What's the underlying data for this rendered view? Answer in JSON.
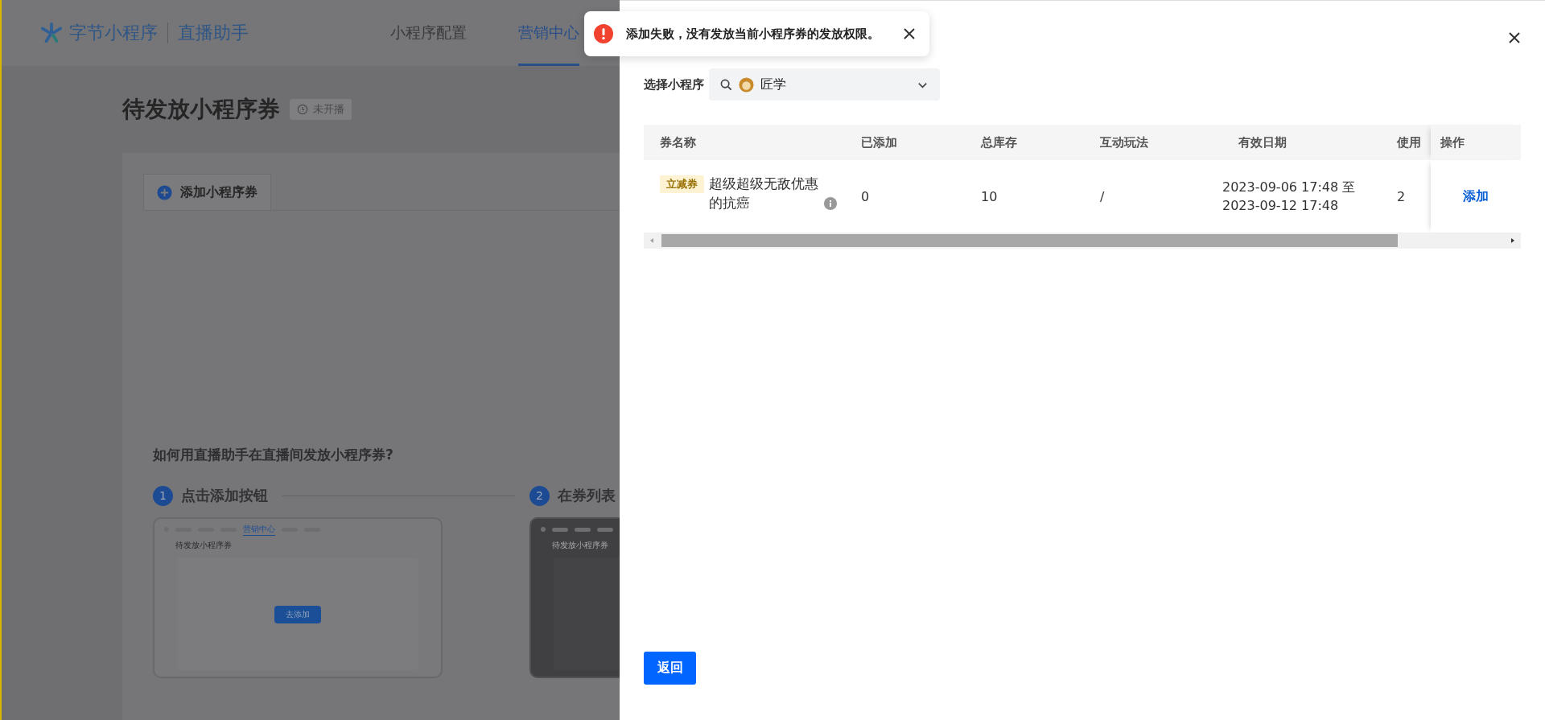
{
  "background_page": {
    "header": {
      "logo": "字节小程序",
      "product": "直播助手",
      "nav": [
        {
          "label": "小程序配置",
          "selected": false
        },
        {
          "label": "营销中心",
          "selected": true
        }
      ]
    },
    "title": "待发放小程序券",
    "status_badge": "未开播",
    "tabs": [
      {
        "label": "添加小程序券",
        "selected": true
      }
    ],
    "guide": {
      "heading": "如何用直播助手在直播间发放小程序券?",
      "steps": [
        {
          "number": "1",
          "label": "点击添加按钮",
          "preview": {
            "kind": "light",
            "nav_label": "营销中心",
            "title": "待发放小程序券",
            "button": "去添加"
          }
        },
        {
          "number": "2",
          "label": "在券列表",
          "preview": {
            "kind": "dark",
            "title": "待发放小程序券"
          }
        }
      ]
    }
  },
  "toast": {
    "kind": "error",
    "message": "添加失败，没有发放当前小程序券的发放权限。"
  },
  "drawer": {
    "selector_label": "选择小程序",
    "selector_value": "匠学",
    "table": {
      "columns": [
        "券名称",
        "已添加",
        "总库存",
        "互动玩法",
        "有效日期",
        "使用",
        "操作"
      ],
      "rows": [
        {
          "tag": "立减券",
          "name": "超级超级无敌优惠的抗癌",
          "added": "0",
          "stock": "10",
          "play": "/",
          "valid_from": "2023-09-06 17:48 至",
          "valid_to": "2023-09-12 17:48",
          "usage": "2",
          "action": "添加"
        }
      ]
    },
    "back_button": "返回"
  }
}
